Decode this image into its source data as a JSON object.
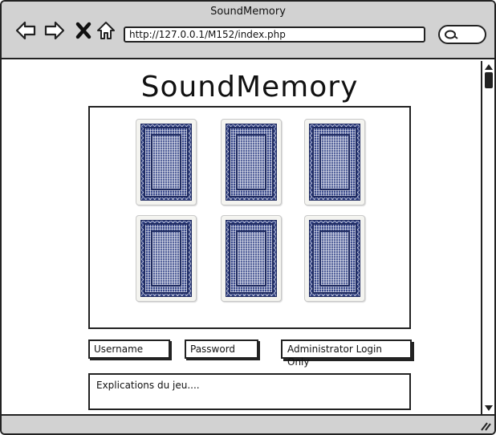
{
  "window": {
    "title": "SoundMemory"
  },
  "toolbar": {
    "back_icon": "back-arrow-icon",
    "forward_icon": "forward-arrow-icon",
    "stop_icon": "close-x-icon",
    "home_icon": "home-icon",
    "url": "http://127.0.0.1/M152/index.php",
    "search_icon": "search-icon"
  },
  "page": {
    "title": "SoundMemory",
    "cards": [
      {
        "state": "face-down"
      },
      {
        "state": "face-down"
      },
      {
        "state": "face-down"
      },
      {
        "state": "face-down"
      },
      {
        "state": "face-down"
      },
      {
        "state": "face-down"
      }
    ],
    "login": {
      "username_placeholder": "Username",
      "password_placeholder": "Password",
      "admin_button_label": "Administrator Login Only"
    },
    "explanation": "Explications du jeu...."
  },
  "colors": {
    "chrome": "#d2d2d2",
    "card_back": "#2f3f80",
    "border": "#222222"
  }
}
